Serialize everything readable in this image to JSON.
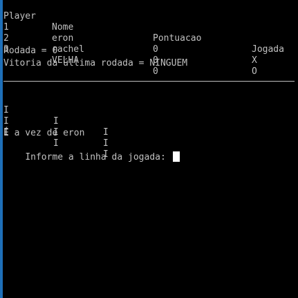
{
  "table": {
    "headers": {
      "player": "Player",
      "nome": "Nome",
      "pontuacao": "Pontuacao",
      "jogada": "Jogada"
    },
    "rows": [
      {
        "player": "1",
        "nome": "eron",
        "pontuacao": "0",
        "jogada": "X"
      },
      {
        "player": "2",
        "nome": "rachel",
        "pontuacao": "0",
        "jogada": "O"
      },
      {
        "player": "3",
        "nome": "VELHA",
        "pontuacao": "0",
        "jogada": ""
      }
    ]
  },
  "status": {
    "rodada": "Rodada = 0",
    "vitoria": "Vitoria da última rodada = NINGUEM"
  },
  "board": {
    "rows": [
      [
        "I",
        "I",
        "I"
      ],
      [
        "I",
        "I",
        "I"
      ],
      [
        "I",
        "I",
        "I"
      ]
    ]
  },
  "prompt": {
    "turn": "É a vez de eron",
    "input_label": "Informe a linha da jogada: "
  },
  "colors": {
    "background": "#000000",
    "text": "#c0c0c0",
    "accent_strip": "#1e6fb8"
  }
}
